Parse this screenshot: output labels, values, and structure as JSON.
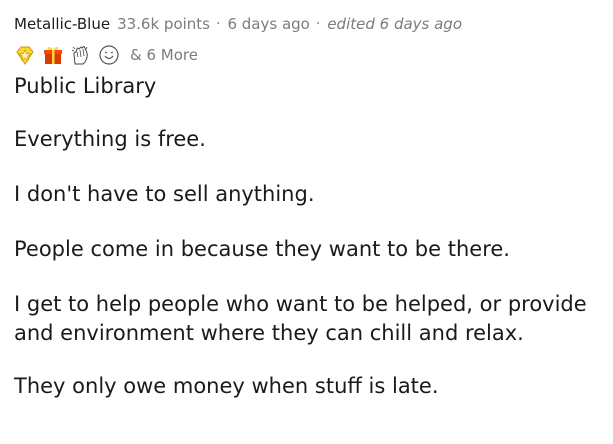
{
  "comment": {
    "author": "Metallic-Blue",
    "points": "33.6k points",
    "separator": "·",
    "time": "6 days ago",
    "edited": "edited 6 days ago",
    "awards": [
      {
        "icon": "gold-star-award-icon",
        "color": "#f5b800"
      },
      {
        "icon": "gift-award-icon",
        "color": "#d93a00"
      },
      {
        "icon": "clapping-hands-award-icon",
        "color": "#555555"
      },
      {
        "icon": "face-award-icon",
        "color": "#555555"
      }
    ],
    "more_awards": "& 6 More",
    "paragraphs": [
      "Public Library",
      "Everything is free.",
      "I don't have to sell anything.",
      "People come in because they want to be there.",
      "I get to help people who want to be helped, or provide and environment where they can chill and relax.",
      "They only owe money when stuff is late."
    ]
  }
}
